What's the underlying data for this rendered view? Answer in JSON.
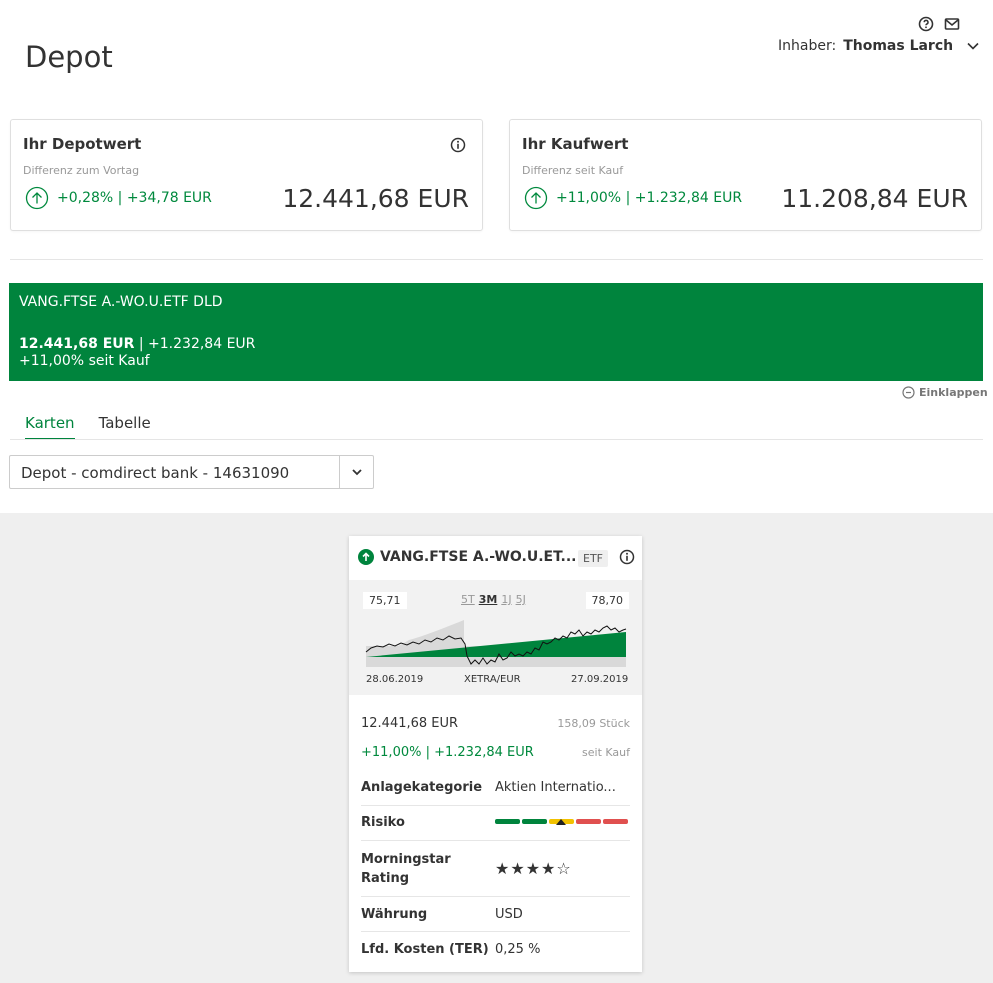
{
  "header": {
    "title": "Depot",
    "owner_label": "Inhaber:",
    "owner_name": "Thomas Larch",
    "icons": [
      "help-icon",
      "mail-icon",
      "chevron-down-icon"
    ]
  },
  "depotwert": {
    "title": "Ihr Depotwert",
    "subtitle": "Differenz zum Vortag",
    "delta": "+0,28% | +34,78 EUR",
    "value": "12.441,68 EUR"
  },
  "kaufwert": {
    "title": "Ihr Kaufwert",
    "subtitle": "Differenz seit Kauf",
    "delta": "+11,00% | +1.232,84 EUR",
    "value": "11.208,84 EUR"
  },
  "banner": {
    "name": "VANG.FTSE A.-WO.U.ETF DLD",
    "value": "12.441,68 EUR",
    "gain": " | +1.232,84 EUR",
    "perf": "+11,00% seit Kauf",
    "color": "#00843d"
  },
  "collapse_label": "Einklappen",
  "tabs": [
    {
      "label": "Karten",
      "active": true
    },
    {
      "label": "Tabelle",
      "active": false
    }
  ],
  "account_select": {
    "value": "Depot - comdirect bank - 14631090"
  },
  "etf_card": {
    "title": "VANG.FTSE A.-WO.U.ET...",
    "badge": "ETF",
    "chart": {
      "low": "75,71",
      "high": "78,70",
      "periods": [
        "5T",
        "3M",
        "1J",
        "5J"
      ],
      "selected_period": "3M",
      "start_date": "28.06.2019",
      "exchange": "XETRA/EUR",
      "end_date": "27.09.2019"
    },
    "value": "12.441,68 EUR",
    "quantity": "158,09 Stück",
    "performance": "+11,00% | +1.232,84 EUR",
    "performance_note": "seit Kauf",
    "rows": {
      "category_label": "Anlagekategorie",
      "category_value": "Aktien Internatio...",
      "risk_label": "Risiko",
      "rating_label_1": "Morningstar",
      "rating_label_2": "Rating",
      "rating_stars": "★★★★☆",
      "rating_value": 4,
      "currency_label": "Währung",
      "currency_value": "USD",
      "ter_label": "Lfd. Kosten (TER)",
      "ter_value": "0,25 %"
    }
  }
}
